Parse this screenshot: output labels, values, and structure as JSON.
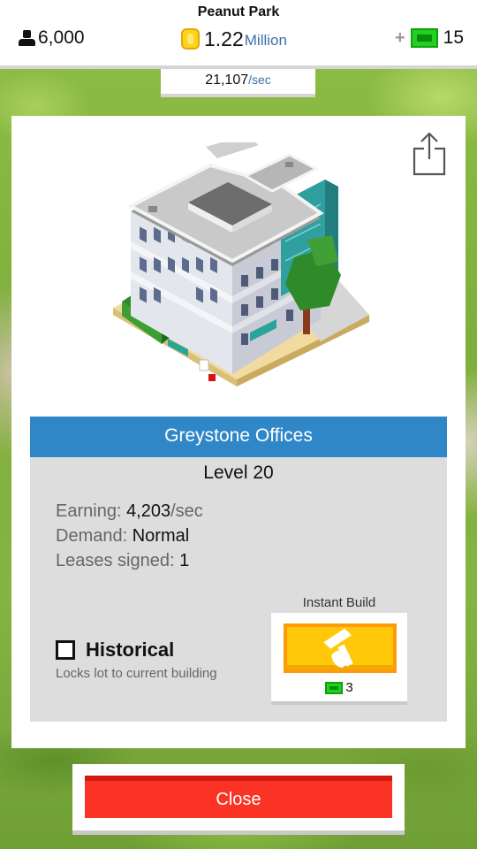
{
  "header": {
    "park_name": "Peanut Park",
    "population": "6,000",
    "money_value": "1.22",
    "money_unit": "Million",
    "cash_plus": "+",
    "cash_count": "15",
    "income_rate": "21,107",
    "income_unit": "/sec"
  },
  "building": {
    "name": "Greystone Offices",
    "level": "Level 20",
    "earning_label": "Earning:",
    "earning_value": "4,203",
    "earning_unit": "/sec",
    "demand_label": "Demand:",
    "demand_value": "Normal",
    "leases_label": "Leases signed:",
    "leases_value": "1"
  },
  "historical": {
    "label": "Historical",
    "description": "Locks lot to current building",
    "checked": false
  },
  "instant_build": {
    "label": "Instant Build",
    "cost": "3"
  },
  "close_label": "Close",
  "icons": {
    "population": "person-icon",
    "money": "coin-icon",
    "cash": "bill-icon",
    "share": "share-icon",
    "instant_build": "hammer-icon"
  },
  "colors": {
    "name_bar": "#2f87c8",
    "instant_build_button": "#ffc90a",
    "close_button": "#fb3325",
    "cash_green": "#22d020"
  }
}
